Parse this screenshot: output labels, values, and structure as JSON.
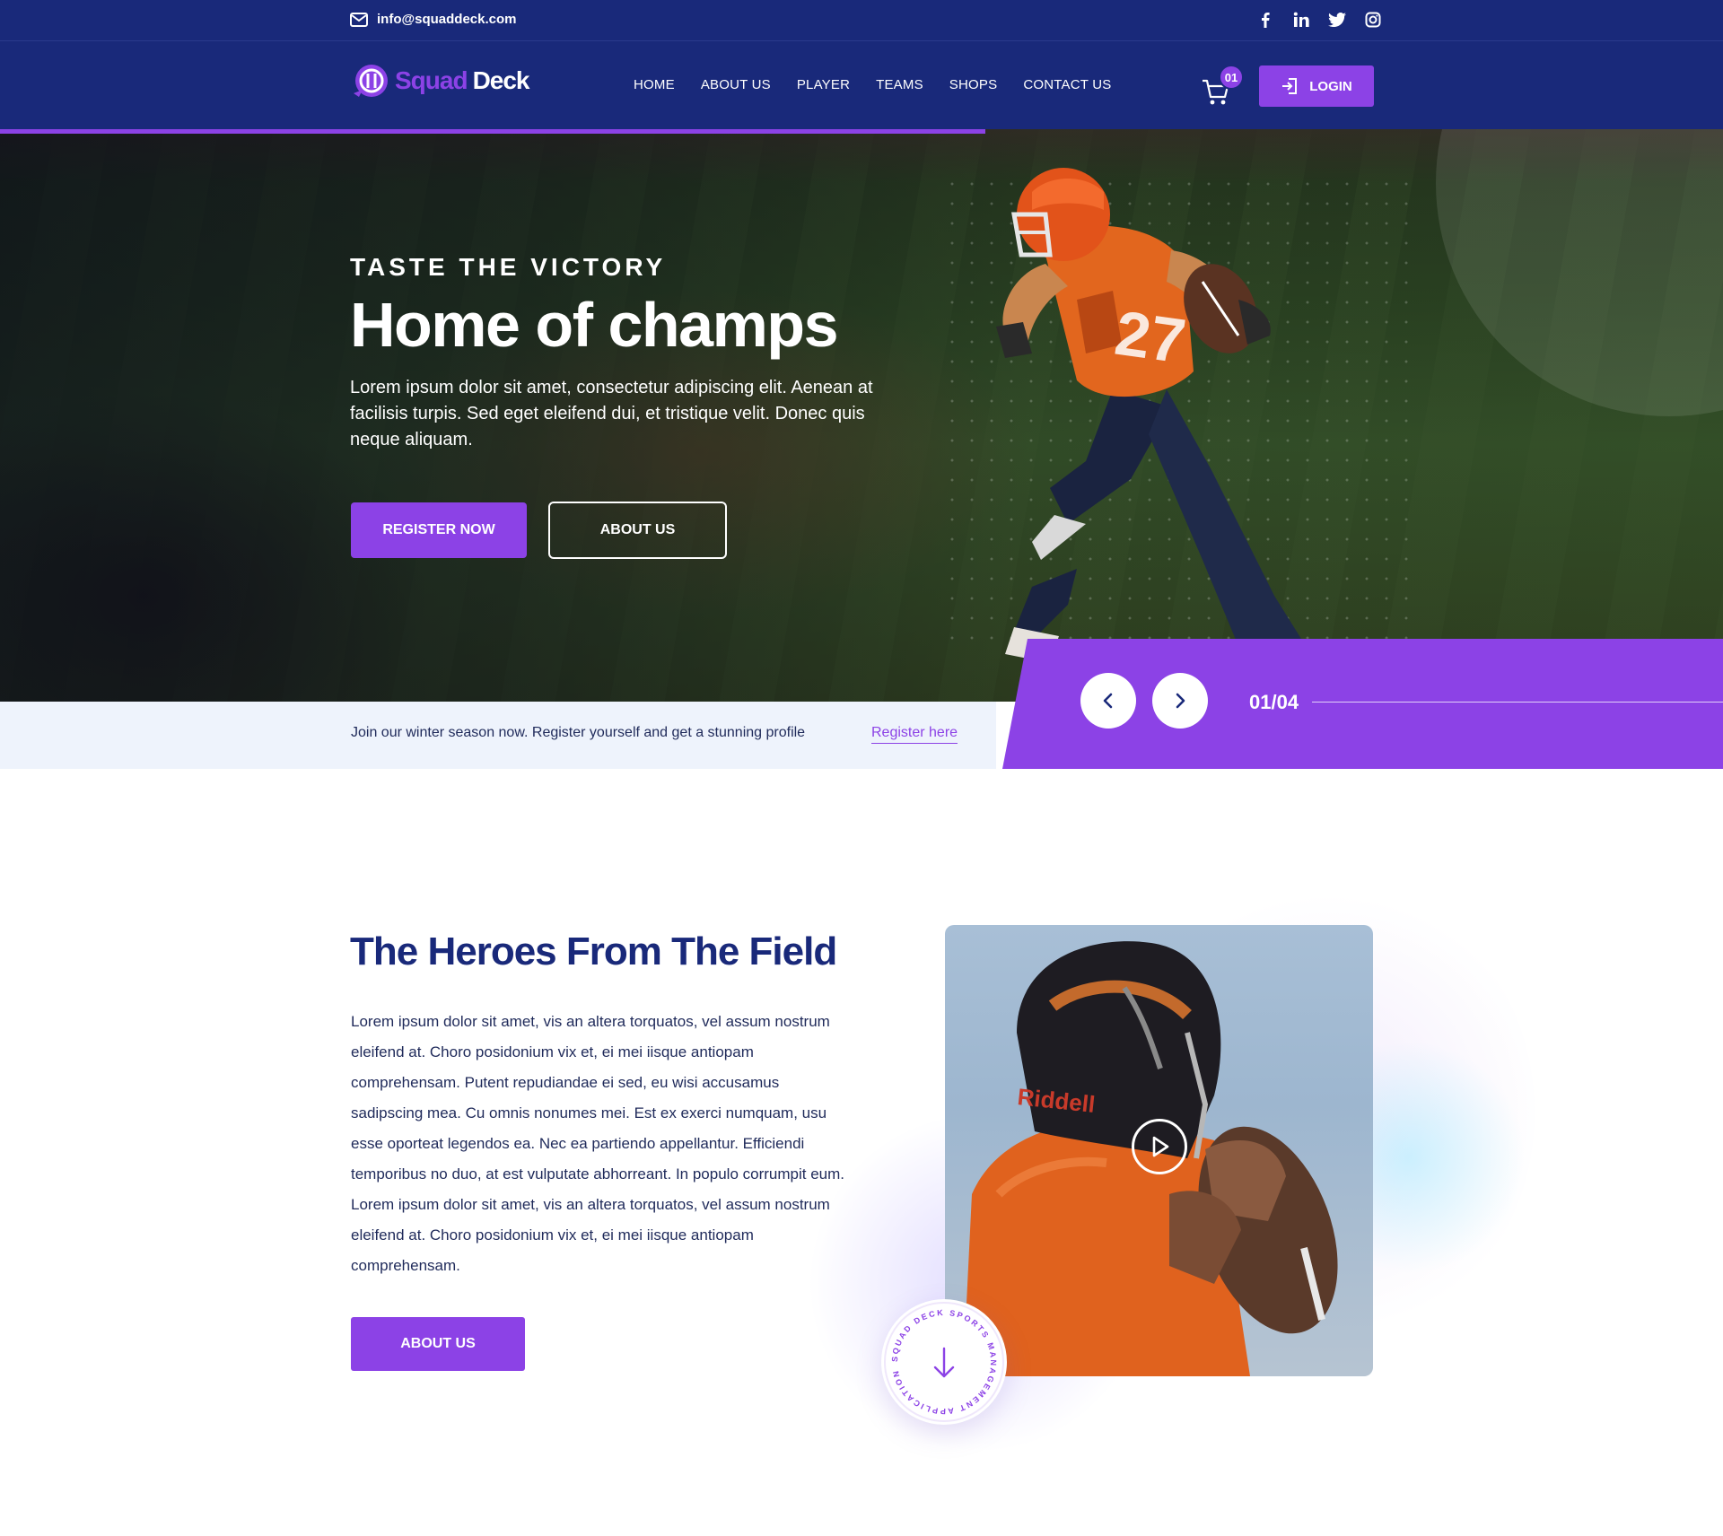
{
  "topbar": {
    "email": "info@squaddeck.com",
    "socials": [
      "facebook-icon",
      "linkedin-icon",
      "twitter-icon",
      "instagram-icon"
    ]
  },
  "header": {
    "logo_part1": "Squad",
    "logo_part2": "Deck",
    "nav": [
      "HOME",
      "ABOUT US",
      "PLAYER",
      "TEAMS",
      "SHOPS",
      "CONTACT US"
    ],
    "cart_count": "01",
    "login_label": "LOGIN"
  },
  "hero": {
    "kicker": "TASTE THE VICTORY",
    "title": "Home of champs",
    "text": "Lorem ipsum dolor sit amet, consectetur adipiscing elit. Aenean at facilisis turpis. Sed eget eleifend dui, et tristique velit. Donec quis neque aliquam.",
    "register_button": "REGISTER NOW",
    "about_button": "ABOUT US",
    "slide_counter": "01/04"
  },
  "announce": {
    "text": "Join our winter season now. Register yourself and get a stunning profile",
    "link": "Register here"
  },
  "heroes_section": {
    "title": "The Heroes From The Field",
    "text": "Lorem ipsum dolor sit amet, vis an altera torquatos, vel assum nostrum eleifend at. Choro posidonium vix et, ei mei iisque antiopam comprehensam. Putent repudiandae ei sed, eu wisi accusamus sadipscing mea. Cu omnis nonumes mei. Est ex exerci numquam, usu esse oporteat legendos ea. Nec ea partiendo appellantur. Efficiendi temporibus no duo, at est vulputate abhorreant. In populo corrumpit eum. Lorem ipsum dolor sit amet, vis an altera torquatos, vel assum nostrum eleifend at. Choro posidonium vix et, ei mei iisque antiopam comprehensam.",
    "button": "ABOUT US",
    "badge_text": "SQUAD DECK SPORTS MANAGEMENT APPLICATION"
  },
  "colors": {
    "navy": "#19297a",
    "accent": "#8c42e6",
    "announce_bg": "#eef3fc"
  }
}
